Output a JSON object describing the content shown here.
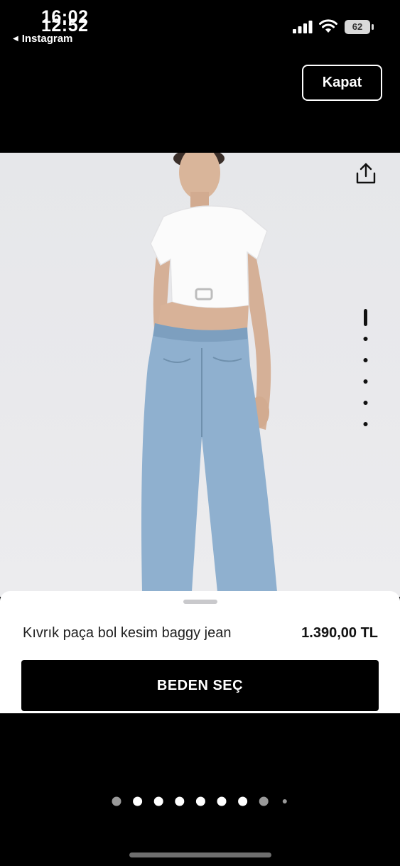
{
  "status_bar": {
    "time_primary": "16:02",
    "time_overlay": "12:52",
    "back_app": "Instagram",
    "battery": "62"
  },
  "header": {
    "close_label": "Kapat"
  },
  "product": {
    "name": "Kıvrık paça bol kesim baggy jean",
    "price": "1.390,00 TL",
    "size_button": "BEDEN SEÇ"
  },
  "image_indicator": {
    "count": 6,
    "active_index": 0
  },
  "page_dots": {
    "count": 9,
    "active_index": 1
  },
  "colors": {
    "background": "#000000",
    "sheet": "#ffffff",
    "button": "#000000"
  },
  "icons": [
    "back-triangle-icon",
    "signal-icon",
    "wifi-icon",
    "battery-icon",
    "share-icon"
  ]
}
